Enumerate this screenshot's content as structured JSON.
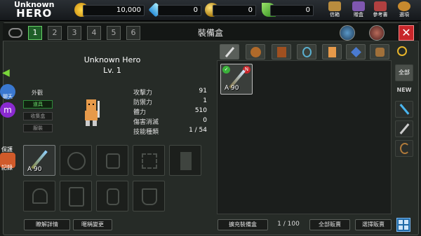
{
  "topbar": {
    "logo_top": "Unknown",
    "logo_bottom": "HERO",
    "gold": "10,000",
    "gems": "0",
    "keys": "0",
    "leaves": "0",
    "btn_mail": "信箱",
    "btn_gift": "贈盒",
    "btn_ref": "參考書",
    "btn_options": "選項"
  },
  "tabs": [
    "1",
    "2",
    "3",
    "4",
    "5",
    "6"
  ],
  "panel_title": "裝備盒",
  "side": {
    "chat": "聊天",
    "protect": "保護",
    "record": "記錄"
  },
  "hero": {
    "name": "Unknown Hero",
    "level": "Lv. 1"
  },
  "appearance": {
    "title": "外觀",
    "buttons": [
      "道具",
      "收集盒",
      "服裝"
    ]
  },
  "stats": [
    {
      "label": "攻擊力",
      "value": "91"
    },
    {
      "label": "防禦力",
      "value": "1"
    },
    {
      "label": "體力",
      "value": "510"
    },
    {
      "label": "傷害消滅",
      "value": "0"
    },
    {
      "label": "技能種類",
      "value": "1 / 54"
    }
  ],
  "equipped_tag": "A 90",
  "inventory_item": {
    "tag": "A 90",
    "badge_n": "N"
  },
  "right_filters": [
    "全部",
    "NEW"
  ],
  "bottom": {
    "detail": "瞭解詳情",
    "change_name": "暱稱變更",
    "expand": "擴充裝備盒",
    "count": "1 / 100",
    "sell_all": "全部販賣",
    "sell_select": "選擇販賣"
  },
  "colors": {
    "selected_tab": "#1f5f28",
    "close": "#c8262a",
    "gold": "#e9b21b",
    "gem": "#4ab6f0",
    "leaf": "#5bc43a"
  }
}
